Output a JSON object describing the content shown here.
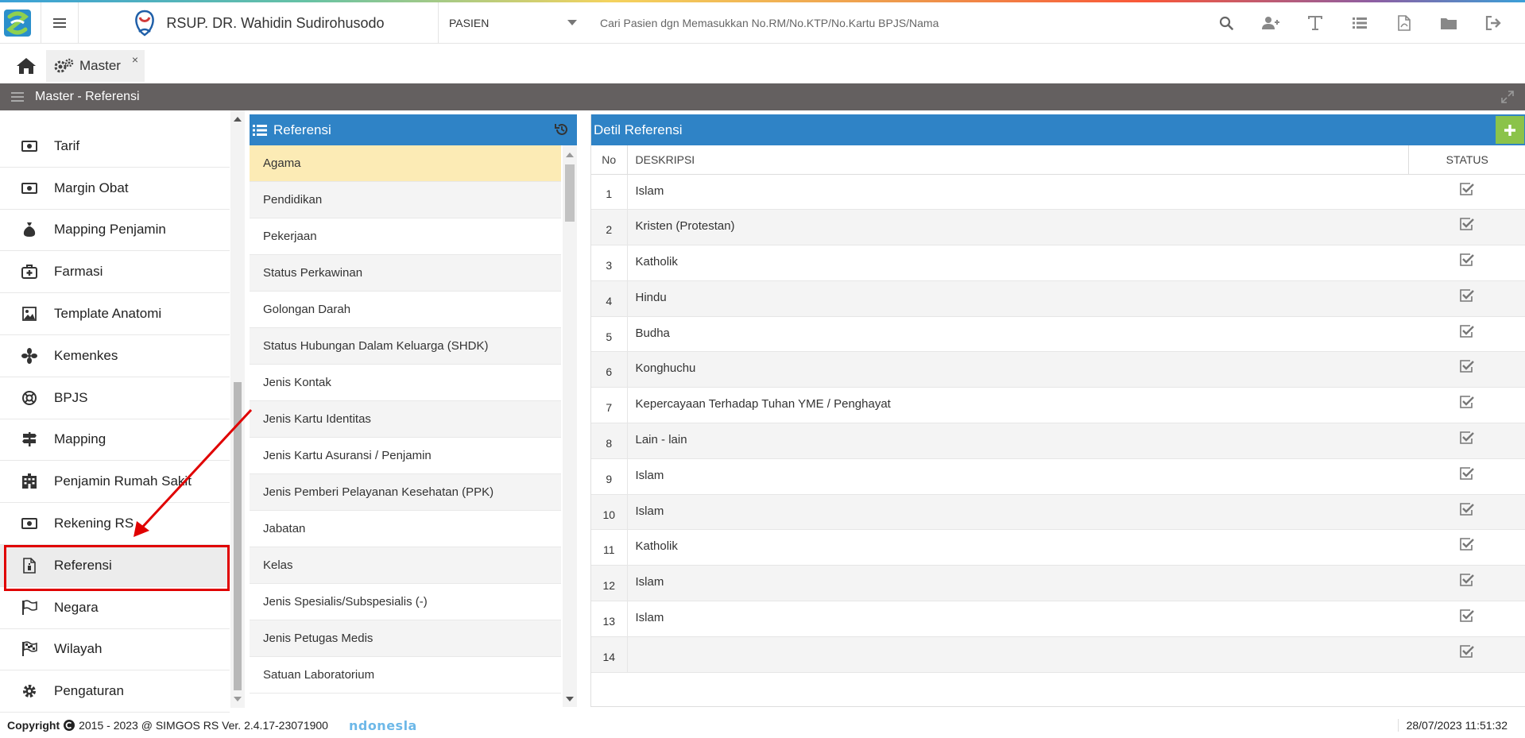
{
  "header": {
    "hospital_name": "RSUP. DR. Wahidin Sudirohusodo",
    "patient_select": "PASIEN",
    "search_placeholder": "Cari Pasien dgn Memasukkan No.RM/No.KTP/No.Kartu BPJS/Nama",
    "icons": [
      "search-icon",
      "add-user-icon",
      "text-icon",
      "list-icon",
      "pdf-icon",
      "folder-icon",
      "logout-icon"
    ]
  },
  "tabs": {
    "master_label": "Master",
    "close_glyph": "×"
  },
  "titlebar": {
    "title": "Master - Referensi"
  },
  "sidebar": {
    "items": [
      {
        "label": "Tarif",
        "icon": "money-icon"
      },
      {
        "label": "Margin Obat",
        "icon": "money-icon"
      },
      {
        "label": "Mapping Penjamin",
        "icon": "money-bag-icon"
      },
      {
        "label": "Farmasi",
        "icon": "medkit-icon"
      },
      {
        "label": "Template Anatomi",
        "icon": "image-icon"
      },
      {
        "label": "Kemenkes",
        "icon": "fan-icon"
      },
      {
        "label": "BPJS",
        "icon": "lifebuoy-icon"
      },
      {
        "label": "Mapping",
        "icon": "signpost-icon"
      },
      {
        "label": "Penjamin Rumah Sakit",
        "icon": "building-icon"
      },
      {
        "label": "Rekening RS",
        "icon": "money-icon"
      },
      {
        "label": "Referensi",
        "icon": "document-icon"
      },
      {
        "label": "Negara",
        "icon": "flag-icon"
      },
      {
        "label": "Wilayah",
        "icon": "checkered-flag-icon"
      },
      {
        "label": "Pengaturan",
        "icon": "gear-icon"
      }
    ],
    "active_index": 10
  },
  "referensi": {
    "title": "Referensi",
    "items": [
      "Agama",
      "Pendidikan",
      "Pekerjaan",
      "Status Perkawinan",
      "Golongan Darah",
      "Status Hubungan Dalam Keluarga (SHDK)",
      "Jenis Kontak",
      "Jenis Kartu Identitas",
      "Jenis Kartu Asuransi / Penjamin",
      "Jenis Pemberi Pelayanan Kesehatan (PPK)",
      "Jabatan",
      "Kelas",
      "Jenis Spesialis/Subspesialis (-)",
      "Jenis Petugas Medis",
      "Satuan Laboratorium"
    ],
    "selected_index": 0
  },
  "detail": {
    "title": "Detil Referensi",
    "columns": {
      "no": "No",
      "desc": "DESKRIPSI",
      "status": "STATUS"
    },
    "rows": [
      {
        "no": "1",
        "desc": "Islam"
      },
      {
        "no": "2",
        "desc": "Kristen (Protestan)"
      },
      {
        "no": "3",
        "desc": "Katholik"
      },
      {
        "no": "4",
        "desc": "Hindu"
      },
      {
        "no": "5",
        "desc": "Budha"
      },
      {
        "no": "6",
        "desc": "Konghuchu"
      },
      {
        "no": "7",
        "desc": "Kepercayaan Terhadap Tuhan YME / Penghayat"
      },
      {
        "no": "8",
        "desc": "Lain - lain"
      },
      {
        "no": "9",
        "desc": "Islam"
      },
      {
        "no": "10",
        "desc": "Islam"
      },
      {
        "no": "11",
        "desc": "Katholik"
      },
      {
        "no": "12",
        "desc": "Islam"
      },
      {
        "no": "13",
        "desc": "Islam"
      },
      {
        "no": "14",
        "desc": ""
      }
    ]
  },
  "footer": {
    "copyright": "Copyright",
    "version": "2015 - 2023 @ SIMGOS RS Ver. 2.4.17-23071900",
    "brand": "ndonesla",
    "datetime": "28/07/2023 11:51:32"
  },
  "colors": {
    "panel_header": "#2f83c6",
    "titlebar": "#646060",
    "selected_row": "#fcebb5",
    "add_button": "#8bc34a",
    "annotation": "#e00000"
  }
}
